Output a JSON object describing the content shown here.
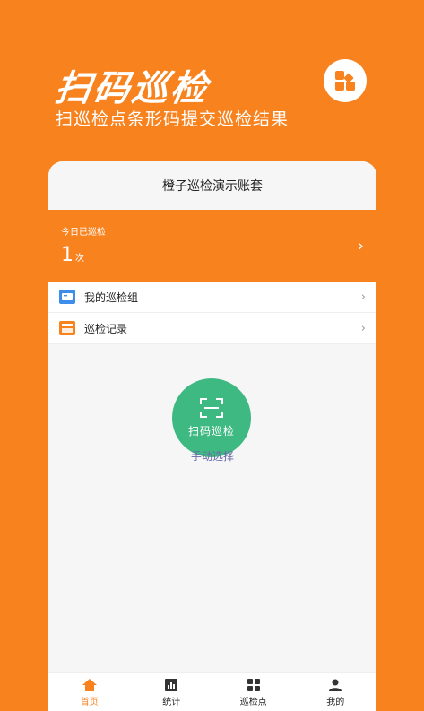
{
  "hero": {
    "title": "扫码巡检",
    "subtitle": "扫巡检点条形码提交巡检结果",
    "icon": "grid-apps-icon"
  },
  "card": {
    "account": "橙子巡检演示账套",
    "today": {
      "label": "今日已巡检",
      "count": "1",
      "unit": "次",
      "arrow": "›"
    },
    "menu": [
      {
        "label": "我的巡检组",
        "icon": "group-card-icon",
        "color": "#3D8EEA",
        "arrow": "›"
      },
      {
        "label": "巡检记录",
        "icon": "record-icon",
        "color": "#F7821E",
        "arrow": "›"
      }
    ],
    "scan": {
      "label": "扫码巡检",
      "icon": "scan-frame-icon",
      "color": "#3FB982"
    },
    "manual": "手动选择"
  },
  "tabbar": [
    {
      "label": "首页",
      "icon": "home-icon",
      "active": true
    },
    {
      "label": "统计",
      "icon": "bar-chart-icon",
      "active": false
    },
    {
      "label": "巡检点",
      "icon": "grid-icon",
      "active": false
    },
    {
      "label": "我的",
      "icon": "person-icon",
      "active": false
    }
  ],
  "colors": {
    "brand": "#F7821E",
    "accent": "#3FB982",
    "link": "#6a6aa8"
  }
}
